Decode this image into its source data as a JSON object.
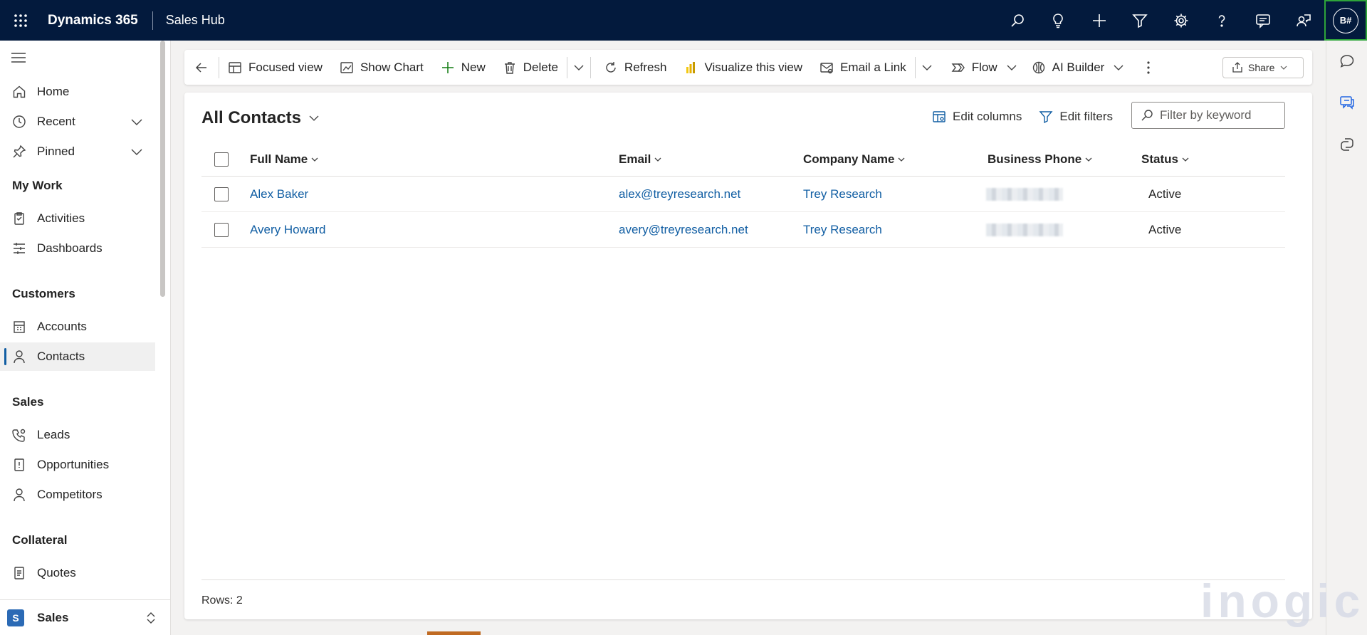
{
  "topbar": {
    "app_name": "Dynamics 365",
    "hub_name": "Sales Hub",
    "avatar_initials": "B#",
    "icons": [
      "search-icon",
      "lightbulb-icon",
      "plus-icon",
      "filter-icon",
      "gear-icon",
      "help-icon",
      "chat-icon",
      "agent-icon"
    ]
  },
  "sidebar": {
    "items": [
      {
        "label": "Home",
        "icon": "home-icon"
      },
      {
        "label": "Recent",
        "icon": "clock-icon"
      },
      {
        "label": "Pinned",
        "icon": "pin-icon"
      }
    ],
    "sections": [
      {
        "label": "My Work",
        "items": [
          {
            "label": "Activities",
            "icon": "clipboard-icon"
          },
          {
            "label": "Dashboards",
            "icon": "dashboard-icon"
          }
        ]
      },
      {
        "label": "Customers",
        "items": [
          {
            "label": "Accounts",
            "icon": "building-icon"
          },
          {
            "label": "Contacts",
            "icon": "person-icon"
          }
        ]
      },
      {
        "label": "Sales",
        "items": [
          {
            "label": "Leads",
            "icon": "phone-person-icon"
          },
          {
            "label": "Opportunities",
            "icon": "document-icon"
          },
          {
            "label": "Competitors",
            "icon": "person-icon"
          }
        ]
      },
      {
        "label": "Collateral",
        "items": [
          {
            "label": "Quotes",
            "icon": "document-icon"
          }
        ]
      }
    ],
    "area": {
      "badge": "S",
      "label": "Sales"
    }
  },
  "commandbar": {
    "focused_view": "Focused view",
    "show_chart": "Show Chart",
    "new": "New",
    "delete": "Delete",
    "refresh": "Refresh",
    "visualize": "Visualize this view",
    "email_link": "Email a Link",
    "flow": "Flow",
    "ai_builder": "AI Builder",
    "share": "Share"
  },
  "view": {
    "title": "All Contacts",
    "edit_columns": "Edit columns",
    "edit_filters": "Edit filters",
    "filter_placeholder": "Filter by keyword",
    "columns": [
      "Full Name",
      "Email",
      "Company Name",
      "Business Phone",
      "Status"
    ],
    "rows": [
      {
        "full_name": "Alex Baker",
        "email": "alex@treyresearch.net",
        "company": "Trey Research",
        "status": "Active"
      },
      {
        "full_name": "Avery Howard",
        "email": "avery@treyresearch.net",
        "company": "Trey Research",
        "status": "Active"
      }
    ],
    "rows_count": "Rows: 2"
  },
  "colors": {
    "topbar_bg": "#031a3d",
    "link": "#115ea3",
    "avatar_highlight": "#2ea43a"
  },
  "watermark": "inogic"
}
